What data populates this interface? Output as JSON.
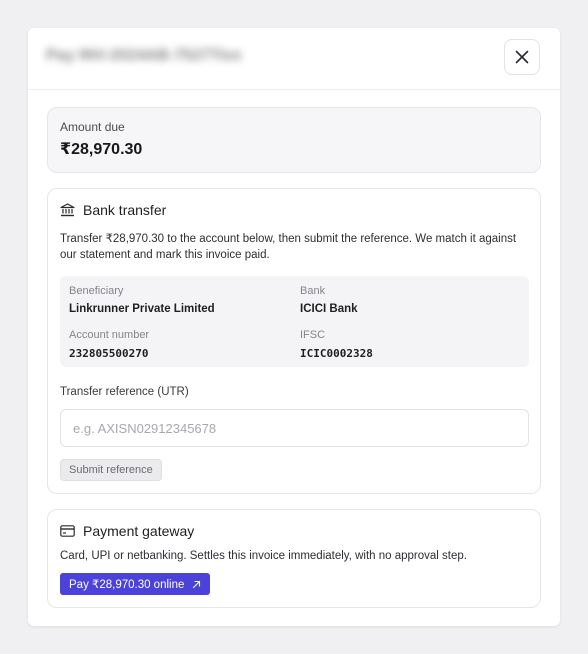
{
  "modal": {
    "title": "Pay INV-2024AB-7527TIxx",
    "close_icon": "close-icon"
  },
  "amount": {
    "label": "Amount due",
    "value": "₹28,970.30"
  },
  "bank_transfer": {
    "icon": "bank-icon",
    "title": "Bank transfer",
    "description": "Transfer ₹28,970.30 to the account below, then submit the reference. We match it against our statement and mark this invoice paid.",
    "details": {
      "beneficiary_label": "Beneficiary",
      "beneficiary_value": "Linkrunner Private Limited",
      "bank_label": "Bank",
      "bank_value": "ICICI Bank",
      "account_label": "Account number",
      "account_value": "232805500270",
      "ifsc_label": "IFSC",
      "ifsc_value": "ICIC0002328"
    },
    "utr_label": "Transfer reference (UTR)",
    "utr_value": "",
    "utr_placeholder": "e.g. AXISN02912345678",
    "submit_label": "Submit reference"
  },
  "payment_gateway": {
    "icon": "card-icon",
    "title": "Payment gateway",
    "description": "Card, UPI or netbanking. Settles this invoice immediately, with no approval step.",
    "pay_label": "Pay ₹28,970.30 online",
    "pay_icon": "external-link-icon"
  },
  "colors": {
    "accent": "#4b42d9",
    "background": "#f0f0f2"
  }
}
